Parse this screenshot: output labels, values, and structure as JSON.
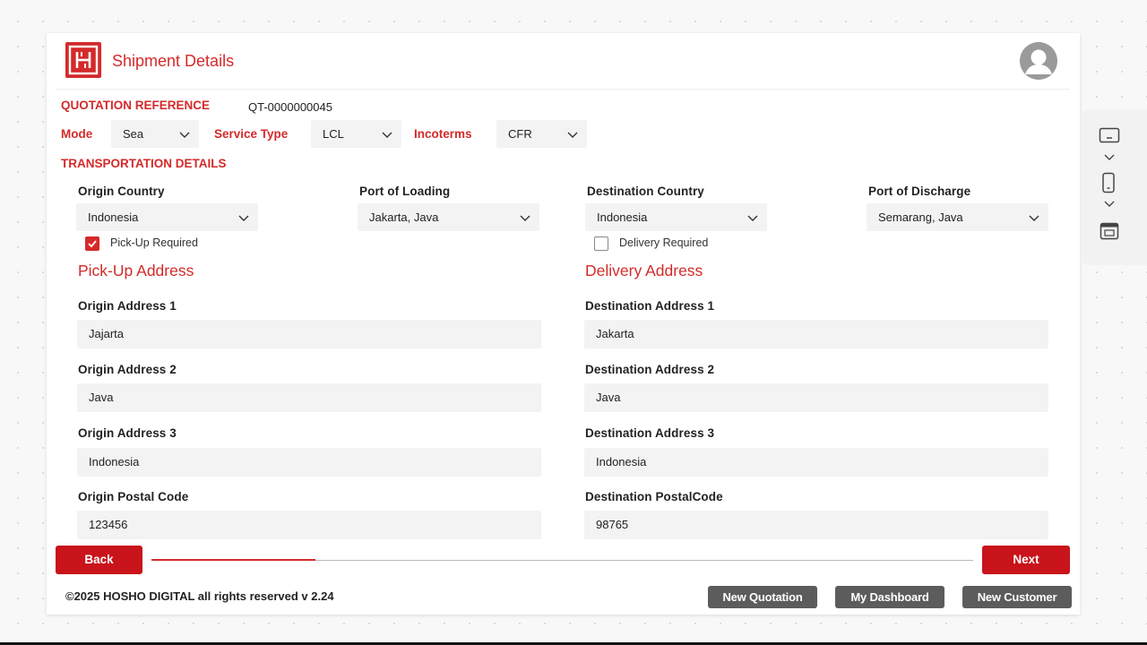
{
  "header": {
    "title": "Shipment Details",
    "logo_icon": "hosho-logo-icon",
    "avatar_icon": "user-avatar-icon"
  },
  "quotation": {
    "label": "QUOTATION REFERENCE",
    "value": "QT-0000000045"
  },
  "filters": {
    "mode_label": "Mode",
    "mode_value": "Sea",
    "service_label": "Service Type",
    "service_value": "LCL",
    "incoterms_label": "Incoterms",
    "incoterms_value": "CFR"
  },
  "transport": {
    "heading": "TRANSPORTATION DETAILS",
    "origin_country_label": "Origin Country",
    "origin_country_value": "Indonesia",
    "port_loading_label": "Port of Loading",
    "port_loading_value": "Jakarta, Java",
    "dest_country_label": "Destination Country",
    "dest_country_value": "Indonesia",
    "port_discharge_label": "Port of Discharge",
    "port_discharge_value": "Semarang, Java",
    "pickup_required_label": "Pick-Up Required",
    "pickup_required": true,
    "delivery_required_label": "Delivery Required",
    "delivery_required": false
  },
  "pickup": {
    "title": "Pick-Up Address",
    "addr1_label": "Origin Address 1",
    "addr1_value": "Jajarta",
    "addr2_label": "Origin Address 2",
    "addr2_value": "Java",
    "addr3_label": "Origin Address 3",
    "addr3_value": "Indonesia",
    "postal_label": "Origin Postal Code",
    "postal_value": "123456"
  },
  "delivery": {
    "title": "Delivery Address",
    "addr1_label": "Destination Address 1",
    "addr1_value": "Jakarta",
    "addr2_label": "Destination Address 2",
    "addr2_value": "Java",
    "addr3_label": "Destination Address 3",
    "addr3_value": "Indonesia",
    "postal_label": "Destination PostalCode",
    "postal_value": "98765"
  },
  "nav": {
    "back_label": "Back",
    "next_label": "Next",
    "progress_fraction": 0.2
  },
  "footer": {
    "copyright": "©2025 HOSHO DIGITAL all rights reserved v 2.24",
    "new_quotation_label": "New Quotation",
    "dashboard_label": "My Dashboard",
    "new_customer_label": "New Customer"
  },
  "side_panel": {
    "icons": [
      "desktop-view-icon",
      "chevron-down-icon",
      "mobile-view-icon",
      "chevron-down-icon",
      "browser-window-icon"
    ]
  },
  "colors": {
    "accent": "#d42a2a",
    "button_red": "#c8141a",
    "button_grey": "#5c5c5c",
    "field_bg": "#f3f3f3"
  }
}
